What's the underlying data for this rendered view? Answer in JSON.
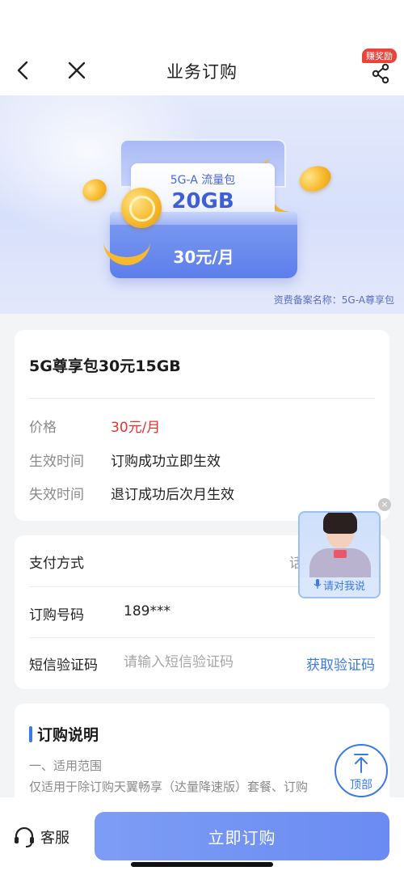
{
  "nav": {
    "title": "业务订购",
    "reward_badge": "赚奖励"
  },
  "banner": {
    "card_sub": "5G-A 流量包",
    "card_main": "20GB",
    "price": "30元/月",
    "note": "资费备案名称：5G-A尊享包"
  },
  "product": {
    "name": "5G尊享包30元15GB",
    "rows": [
      {
        "label": "价格",
        "value": "30元/月"
      },
      {
        "label": "生效时间",
        "value": "订购成功立即生效"
      },
      {
        "label": "失效时间",
        "value": "退订成功后次月生效"
      }
    ],
    "accent_color": "#e0332f"
  },
  "order_form": {
    "payment_label": "支付方式",
    "payment_value": "话费",
    "phone_label": "订购号码",
    "phone_value": "189***",
    "sms_label": "短信验证码",
    "sms_placeholder": "请输入短信验证码",
    "get_code": "获取验证码",
    "link_color": "#3b79e8"
  },
  "description": {
    "title": "订购说明",
    "subtitle": "一、适用范围",
    "text": "仅适用于除订购天翼畅享（达量降速版）套餐、订购"
  },
  "assistant": {
    "label": "请对我说",
    "close": "×"
  },
  "to_top": {
    "label": "顶部"
  },
  "bottom": {
    "service_label": "客服",
    "order_button": "立即订购"
  }
}
